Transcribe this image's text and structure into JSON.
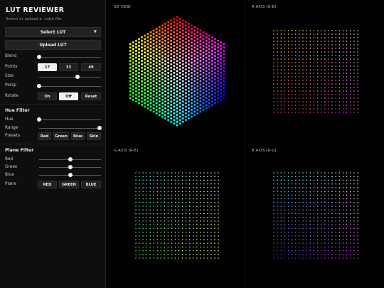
{
  "app": {
    "title": "LUT REVIEWER",
    "subtitle": "Select or upload a .cube file"
  },
  "buttons": {
    "select_lut": "Select LUT",
    "upload_lut": "Upload LUT"
  },
  "controls": {
    "blend": {
      "label": "Blend",
      "value": 0
    },
    "points": {
      "label": "Points",
      "options": [
        "17",
        "33",
        "49"
      ],
      "selected": "17"
    },
    "size": {
      "label": "Size",
      "value": 0.62
    },
    "persp": {
      "label": "Persp",
      "value": 0
    },
    "rotate": {
      "label": "Rotate",
      "options": [
        "On",
        "Off",
        "Reset"
      ],
      "selected": "Off"
    }
  },
  "hue_filter": {
    "heading": "Hue Filter",
    "hue": {
      "label": "Hue",
      "value": 0
    },
    "range": {
      "label": "Range",
      "value": 1
    },
    "presets": {
      "label": "Presets",
      "options": [
        "Red",
        "Green",
        "Blue",
        "Skin"
      ]
    }
  },
  "plane_filter": {
    "heading": "Plane Filter",
    "red": {
      "label": "Red",
      "value": 0.5
    },
    "green": {
      "label": "Green",
      "value": 0.5
    },
    "blue": {
      "label": "Blue",
      "value": 0.5
    },
    "plane": {
      "label": "Plane",
      "options": [
        "RED",
        "GREEN",
        "BLUE"
      ]
    }
  },
  "views": {
    "view_3d": "3D VIEW",
    "r_axis": "R AXIS (G-B)",
    "g_axis": "G AXIS (R-B)",
    "b_axis": "B AXIS (R-G)"
  },
  "icons": {
    "dropdown": "chevron-down-icon"
  }
}
